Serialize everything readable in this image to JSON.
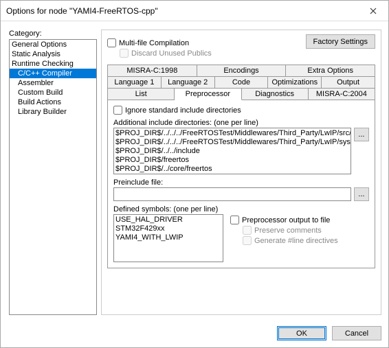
{
  "window": {
    "title": "Options for node \"YAMI4-FreeRTOS-cpp\""
  },
  "category": {
    "label": "Category:",
    "items": [
      "General Options",
      "Static Analysis",
      "Runtime Checking",
      "C/C++ Compiler",
      "Assembler",
      "Custom Build",
      "Build Actions",
      "Library Builder"
    ],
    "selected": 3
  },
  "panel": {
    "factory": "Factory Settings",
    "multi_file": "Multi-file Compilation",
    "discard": "Discard Unused Publics",
    "tabs_row1": [
      "MISRA-C:1998",
      "Encodings",
      "Extra Options"
    ],
    "tabs_row2": [
      "Language 1",
      "Language 2",
      "Code",
      "Optimizations",
      "Output"
    ],
    "tabs_row3": [
      "List",
      "Preprocessor",
      "Diagnostics",
      "MISRA-C:2004"
    ],
    "active_tab": "Preprocessor",
    "ignore_std": "Ignore standard include directories",
    "addl_label": "Additional include directories: (one per line)",
    "addl_value": "$PROJ_DIR$/../../../FreeRTOSTest/Middlewares/Third_Party/LwIP/src/include\n$PROJ_DIR$/../../../FreeRTOSTest/Middlewares/Third_Party/LwIP/system\n$PROJ_DIR$/../../include\n$PROJ_DIR$/freertos\n$PROJ_DIR$/../core/freertos",
    "preinc_label": "Preinclude file:",
    "preinc_value": "",
    "defsym_label": "Defined symbols: (one per line)",
    "defsym_value": "USE_HAL_DRIVER\nSTM32F429xx\nYAMI4_WITH_LWIP",
    "pp_out": "Preprocessor output to file",
    "preserve": "Preserve comments",
    "genline": "Generate #line directives",
    "browse": "..."
  },
  "footer": {
    "ok": "OK",
    "cancel": "Cancel"
  }
}
